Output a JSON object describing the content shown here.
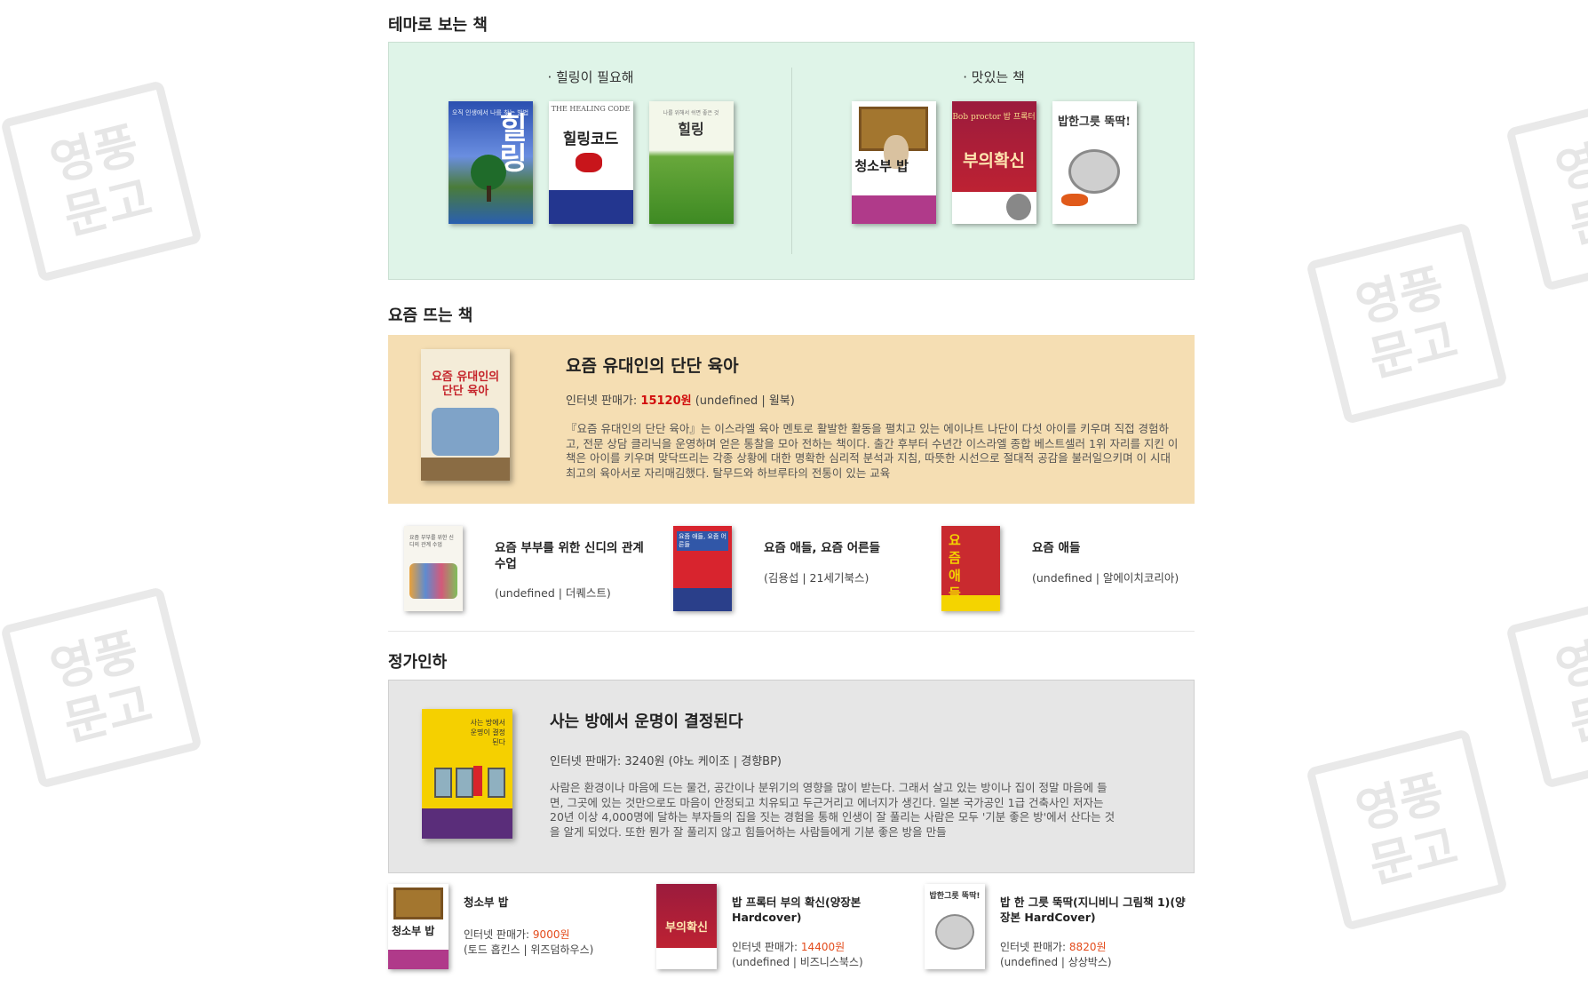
{
  "watermark": {
    "text": "영풍문고"
  },
  "theme": {
    "section_title": "테마로 보는 책",
    "columns": [
      {
        "label": "· 힐링이 필요해",
        "books": [
          {
            "cover_text": "힐링",
            "cover_sub": "오직 인생에서 나를 찾는 방법"
          },
          {
            "cover_text": "힐링코드",
            "cover_sub": "THE HEALING CODE"
          },
          {
            "cover_text": "힐링",
            "cover_sub": "나를 위해서 쉬면 좋은 것"
          }
        ]
      },
      {
        "label": "· 맛있는 책",
        "books": [
          {
            "cover_text": "청소부 밥",
            "cover_sub": ""
          },
          {
            "cover_text": "부의확신",
            "cover_sub": "Bob proctor 밥 프록터"
          },
          {
            "cover_text": "밥한그릇 뚝딱!",
            "cover_sub": ""
          }
        ]
      }
    ]
  },
  "hot": {
    "section_title": "요즘 뜨는 책",
    "featured": {
      "title": "요즘 유대인의 단단 육아",
      "cover_text": "요즘 유대인의 단단 육아",
      "price_label": "인터넷 판매가: ",
      "price": "15120원",
      "meta": " (undefined | 윌북)",
      "description": "『요즘 유대인의 단단 육아』는 이스라엘 육아 멘토로 활발한 활동을 펼치고 있는 에이나트 나단이 다섯 아이를 키우며 직접 경험하고, 전문 상담 클리닉을 운영하며 얻은 통찰을 모아 전하는 책이다. 출간 후부터 수년간 이스라엘 종합 베스트셀러 1위 자리를 지킨 이 책은 아이를 키우며 맞닥뜨리는 각종 상황에 대한 명확한 심리적 분석과 지침, 따뜻한 시선으로 절대적 공감을 불러일으키며 이 시대 최고의 육아서로 자리매김했다. 탈무드와 하브루타의 전통이 있는 교육"
    },
    "items": [
      {
        "title": "요즘 부부를 위한 신디의 관계 수업",
        "meta": "(undefined | 더퀘스트)",
        "cover_text": "요즘 부부를 위한 신디의 관계 수업"
      },
      {
        "title": "요즘 애들, 요즘 어른들",
        "meta": "(김용섭 | 21세기북스)",
        "cover_text": "요즘 애들, 요즘 어른들"
      },
      {
        "title": "요즘 애들",
        "meta": "(undefined | 알에이치코리아)",
        "cover_text": "요즘 애들"
      }
    ]
  },
  "discount": {
    "section_title": "정가인하",
    "featured": {
      "title": "사는 방에서 운명이 결정된다",
      "cover_text": "사는 방에서 운명이 결정된다",
      "price_line": "인터넷 판매가: 3240원 (야노 케이조 | 경향BP)",
      "description": "사람은 환경이나 마음에 드는 물건, 공간이나 분위기의 영향을 많이 받는다. 그래서 살고 있는 방이나 집이 정말 마음에 들면, 그곳에 있는 것만으로도 마음이 안정되고 치유되고 두근거리고 에너지가 생긴다. 일본 국가공인 1급 건축사인 저자는 20년 이상 4,000명에 달하는 부자들의 집을 짓는 경험을 통해 인생이 잘 풀리는 사람은 모두 '기분 좋은 방'에서 산다는 것을 알게 되었다. 또한 뭔가 잘 풀리지 않고 힘들어하는 사람들에게 기분 좋은 방을 만들"
    },
    "items": [
      {
        "title": "청소부 밥",
        "price_label": "인터넷 판매가: ",
        "price": "9000원",
        "meta": "(토드 홉킨스 | 위즈덤하우스)",
        "cover_text": "청소부 밥"
      },
      {
        "title": "밥 프록터 부의 확신(양장본 Hardcover)",
        "price_label": "인터넷 판매가: ",
        "price": "14400원",
        "meta": "(undefined | 비즈니스북스)",
        "cover_text": "부의확신"
      },
      {
        "title": "밥 한 그릇 뚝딱(지니비니 그림책 1)(양장본 HardCover)",
        "price_label": "인터넷 판매가: ",
        "price": "8820원",
        "meta": "(undefined | 상상박스)",
        "cover_text": "밥한그릇 뚝딱!"
      }
    ]
  }
}
